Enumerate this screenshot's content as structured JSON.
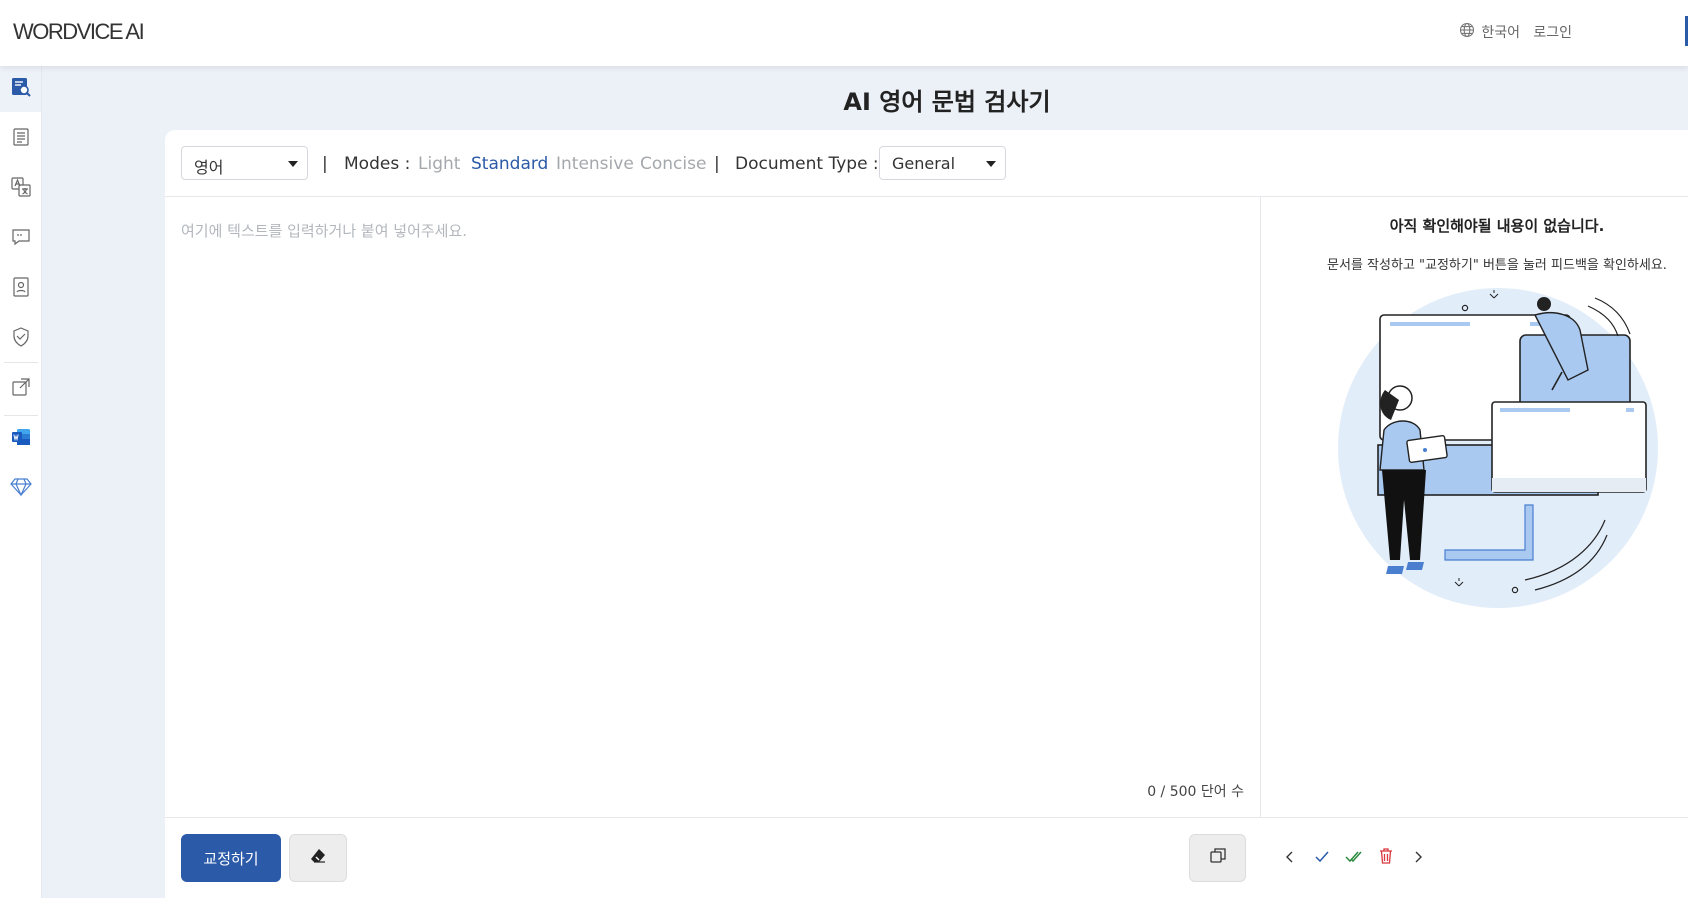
{
  "header": {
    "logo": "WORDVICE AI",
    "language_label": "한국어",
    "login_label": "로그인"
  },
  "sidebar": {
    "items": [
      {
        "icon": "grammar-check-icon",
        "active": true
      },
      {
        "icon": "document-list-icon",
        "active": false
      },
      {
        "icon": "translate-icon",
        "active": false
      },
      {
        "icon": "chat-bubble-icon",
        "active": false
      },
      {
        "icon": "id-card-icon",
        "active": false
      },
      {
        "icon": "shield-check-icon",
        "active": false
      },
      {
        "icon": "external-link-icon",
        "active": false
      },
      {
        "icon": "word-app-icon",
        "active": false
      },
      {
        "icon": "diamond-icon",
        "active": false
      }
    ]
  },
  "page": {
    "title": "AI 영어 문법 검사기"
  },
  "toolbar": {
    "language_select": "영어",
    "separator": "|",
    "modes_label": "Modes :",
    "modes": [
      "Light",
      "Standard",
      "Intensive",
      "Concise"
    ],
    "active_mode": "Standard",
    "doc_type_label": "Document Type :",
    "doc_type_select": "General"
  },
  "editor": {
    "placeholder": "여기에 텍스트를 입력하거나 붙여 넣어주세요.",
    "word_count": "0 / 500 단어 수"
  },
  "feedback": {
    "title": "아직 확인해야될 내용이 없습니다.",
    "subtitle": "문서를 작성하고 \"교정하기\" 버튼을 눌러 피드백을 확인하세요."
  },
  "footer": {
    "submit_label": "교정하기"
  },
  "colors": {
    "brand": "#2b5aa8",
    "background": "#ecf0f7",
    "accept": "#2b8a3e",
    "delete": "#d9363e",
    "illustration_blue": "#a9c9f0"
  }
}
